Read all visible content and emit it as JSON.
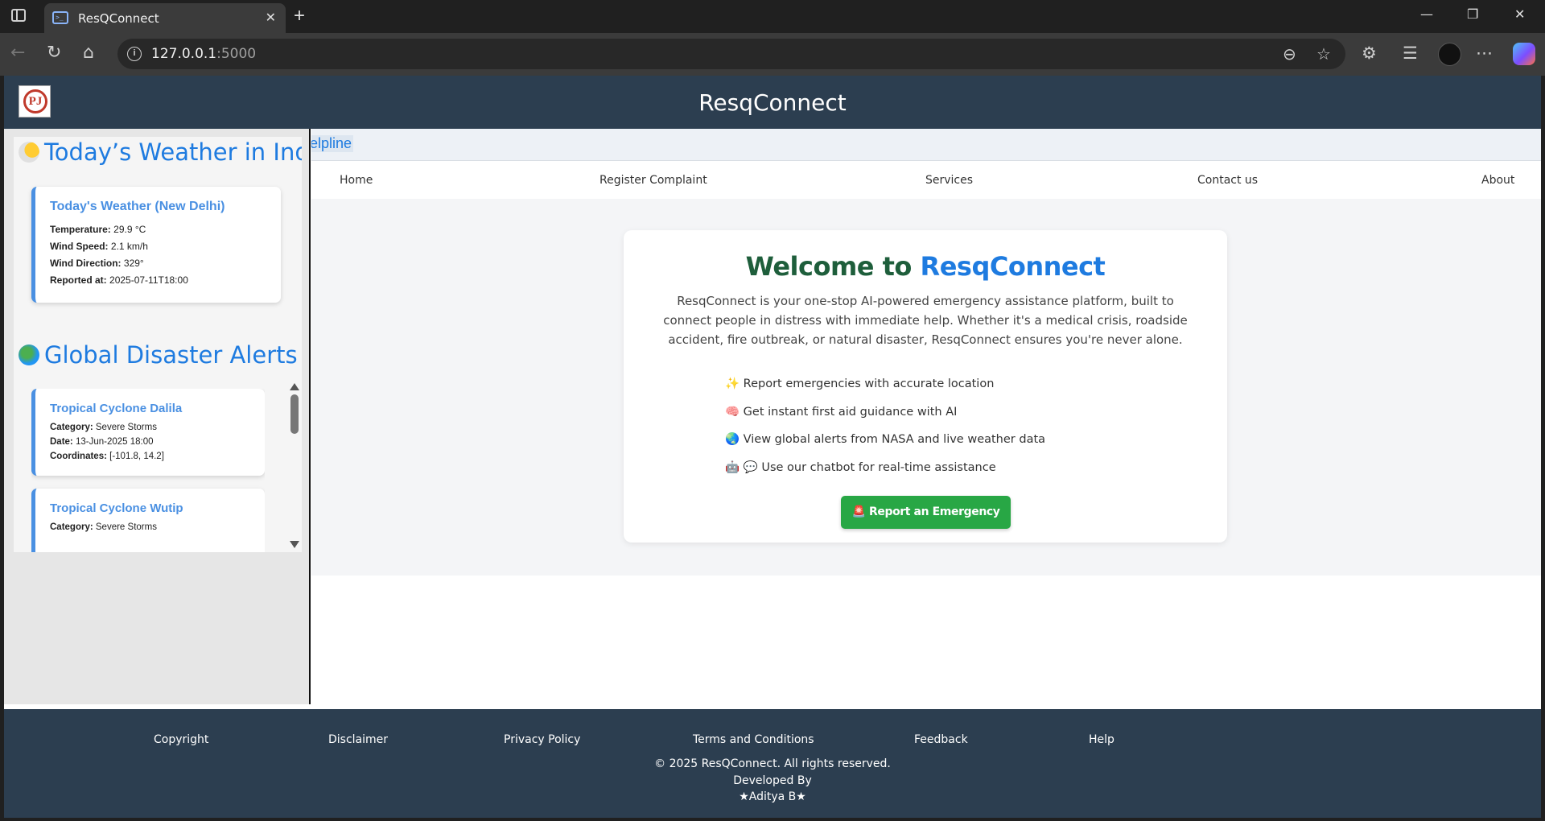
{
  "browser": {
    "tab_title": "ResQConnect",
    "tab_close": "✕",
    "new_tab": "+",
    "url_host": "127.0.0.1",
    "url_port": ":5000",
    "window_controls": [
      "—",
      "❐",
      "✕"
    ]
  },
  "header": {
    "logo_text": "PJ",
    "title": "ResqConnect"
  },
  "aside": {
    "weather_heading": "Today’s Weather in India",
    "weather_card": {
      "title": "Today's Weather (New Delhi)",
      "rows": [
        {
          "label": "Temperature:",
          "value": "29.9 °C"
        },
        {
          "label": "Wind Speed:",
          "value": "2.1 km/h"
        },
        {
          "label": "Wind Direction:",
          "value": "329°"
        },
        {
          "label": "Reported at:",
          "value": "2025-07-11T18:00"
        }
      ]
    },
    "alerts_heading": "Global Disaster Alerts",
    "alerts": [
      {
        "title": "Tropical Cyclone Dalila",
        "rows": [
          {
            "label": "Category:",
            "value": "Severe Storms"
          },
          {
            "label": "Date:",
            "value": "13-Jun-2025 18:00"
          },
          {
            "label": "Coordinates:",
            "value": "[-101.8, 14.2]"
          }
        ]
      },
      {
        "title": "Tropical Cyclone Wutip",
        "rows": [
          {
            "label": "Category:",
            "value": "Severe Storms"
          }
        ]
      }
    ]
  },
  "marquee": "elpline",
  "nav": {
    "home": "Home",
    "register": "Register Complaint",
    "services": "Services",
    "contact": "Contact us",
    "about": "About"
  },
  "hero": {
    "title_prefix": "Welcome to ",
    "title_brand": "ResqConnect",
    "description": "ResqConnect is your one-stop AI-powered emergency assistance platform, built to connect people in distress with immediate help. Whether it's a medical crisis, roadside accident, fire outbreak, or natural disaster, ResqConnect ensures you're never alone.",
    "features": [
      "✨ Report emergencies with accurate location",
      "🧠 Get instant first aid guidance with AI",
      "🌏 View global alerts from NASA and live weather data",
      "🤖 💬 Use our chatbot for real-time assistance"
    ],
    "button": "🚨 Report an Emergency"
  },
  "footer": {
    "links": [
      "Copyright",
      "Disclaimer",
      "Privacy Policy",
      "Terms and Conditions",
      "Feedback",
      "Help"
    ],
    "copyright": "© 2025 ResQConnect. All rights reserved.",
    "developed_by": "Developed By",
    "developer": "★Aditya B★"
  },
  "colors": {
    "header_bg": "#2c3e50",
    "brand_blue": "#1e7be0",
    "welcome_green": "#1e5e3b",
    "button_green": "#28a745"
  }
}
